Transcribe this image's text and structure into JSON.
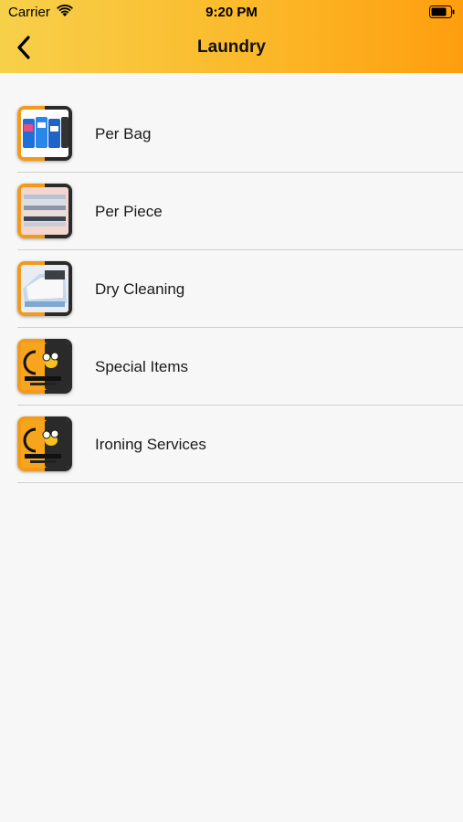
{
  "status_bar": {
    "carrier": "Carrier",
    "time": "9:20 PM"
  },
  "nav": {
    "title": "Laundry",
    "back_icon": "chevron-left-icon"
  },
  "services": [
    {
      "label": "Per Bag",
      "image": "laundry-bags"
    },
    {
      "label": "Per Piece",
      "image": "folded-clothes"
    },
    {
      "label": "Dry Cleaning",
      "image": "dry-cleaning-clothes"
    },
    {
      "label": "Special Items",
      "image": "busybee-logo"
    },
    {
      "label": "Ironing Services",
      "image": "busybee-logo"
    }
  ],
  "colors": {
    "header_start": "#f7d04a",
    "header_end": "#fe9e0e",
    "accent_orange": "#f39a1b",
    "frame_dark": "#2a2a2a"
  }
}
